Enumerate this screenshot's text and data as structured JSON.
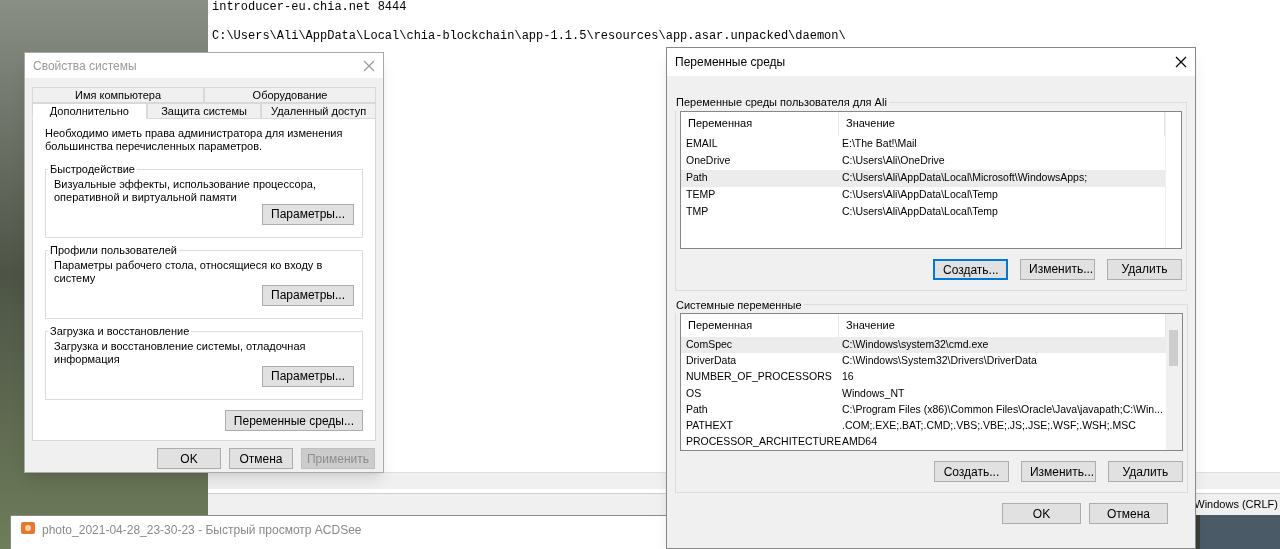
{
  "notepad": {
    "lines": [
      "introducer-eu.chia.net 8444",
      "C:\\Users\\Ali\\AppData\\Local\\chia-blockchain\\app-1.1.5\\resources\\app.asar.unpacked\\daemon\\"
    ],
    "status": "Windows (CRLF)"
  },
  "acdsee": {
    "title": "photo_2021-04-28_23-30-23 - Быстрый просмотр ACDSee"
  },
  "system_properties": {
    "title": "Свойства системы",
    "active": false,
    "tab_rows": [
      [
        {
          "label": "Имя компьютера",
          "selected": false
        },
        {
          "label": "Оборудование",
          "selected": false
        }
      ],
      [
        {
          "label": "Дополнительно",
          "selected": true
        },
        {
          "label": "Защита системы",
          "selected": false
        },
        {
          "label": "Удаленный доступ",
          "selected": false
        }
      ]
    ],
    "note": "Необходимо иметь права администратора для изменения большинства перечисленных параметров.",
    "groups": [
      {
        "title": "Быстродействие",
        "text": "Визуальные эффекты, использование процессора, оперативной и виртуальной памяти",
        "button": "Параметры..."
      },
      {
        "title": "Профили пользователей",
        "text": "Параметры рабочего стола, относящиеся ко входу в систему",
        "button": "Параметры..."
      },
      {
        "title": "Загрузка и восстановление",
        "text": "Загрузка и восстановление системы, отладочная информация",
        "button": "Параметры..."
      }
    ],
    "env_button": "Переменные среды...",
    "buttons": [
      {
        "label": "OK",
        "disabled": false
      },
      {
        "label": "Отмена",
        "disabled": false
      },
      {
        "label": "Применить",
        "disabled": true
      }
    ]
  },
  "environment_variables": {
    "title": "Переменные среды",
    "sections": [
      {
        "title": "Переменные среды пользователя для Ali",
        "columns": [
          "Переменная",
          "Значение"
        ],
        "scrollbar": false,
        "rows": [
          {
            "name": "EMAIL",
            "value": "E:\\The Bat!\\Mail",
            "selected": false
          },
          {
            "name": "OneDrive",
            "value": "C:\\Users\\Ali\\OneDrive",
            "selected": false
          },
          {
            "name": "Path",
            "value": "C:\\Users\\Ali\\AppData\\Local\\Microsoft\\WindowsApps;",
            "selected": true
          },
          {
            "name": "TEMP",
            "value": "C:\\Users\\Ali\\AppData\\Local\\Temp",
            "selected": false
          },
          {
            "name": "TMP",
            "value": "C:\\Users\\Ali\\AppData\\Local\\Temp",
            "selected": false
          }
        ],
        "buttons": [
          {
            "label": "Создать...",
            "focused": true
          },
          {
            "label": "Изменить...",
            "focused": false
          },
          {
            "label": "Удалить",
            "focused": false
          }
        ]
      },
      {
        "title": "Системные переменные",
        "columns": [
          "Переменная",
          "Значение"
        ],
        "scrollbar": true,
        "rows": [
          {
            "name": "ComSpec",
            "value": "C:\\Windows\\system32\\cmd.exe",
            "selected": true
          },
          {
            "name": "DriverData",
            "value": "C:\\Windows\\System32\\Drivers\\DriverData",
            "selected": false
          },
          {
            "name": "NUMBER_OF_PROCESSORS",
            "value": "16",
            "selected": false
          },
          {
            "name": "OS",
            "value": "Windows_NT",
            "selected": false
          },
          {
            "name": "Path",
            "value": "C:\\Program Files (x86)\\Common Files\\Oracle\\Java\\javapath;C:\\Win...",
            "selected": false
          },
          {
            "name": "PATHEXT",
            "value": ".COM;.EXE;.BAT;.CMD;.VBS;.VBE;.JS;.JSE;.WSF;.WSH;.MSC",
            "selected": false
          },
          {
            "name": "PROCESSOR_ARCHITECTURE",
            "value": "AMD64",
            "selected": false
          }
        ],
        "buttons": [
          {
            "label": "Создать...",
            "focused": false
          },
          {
            "label": "Изменить...",
            "focused": false
          },
          {
            "label": "Удалить",
            "focused": false
          }
        ]
      }
    ],
    "buttons": [
      "OK",
      "Отмена"
    ]
  }
}
